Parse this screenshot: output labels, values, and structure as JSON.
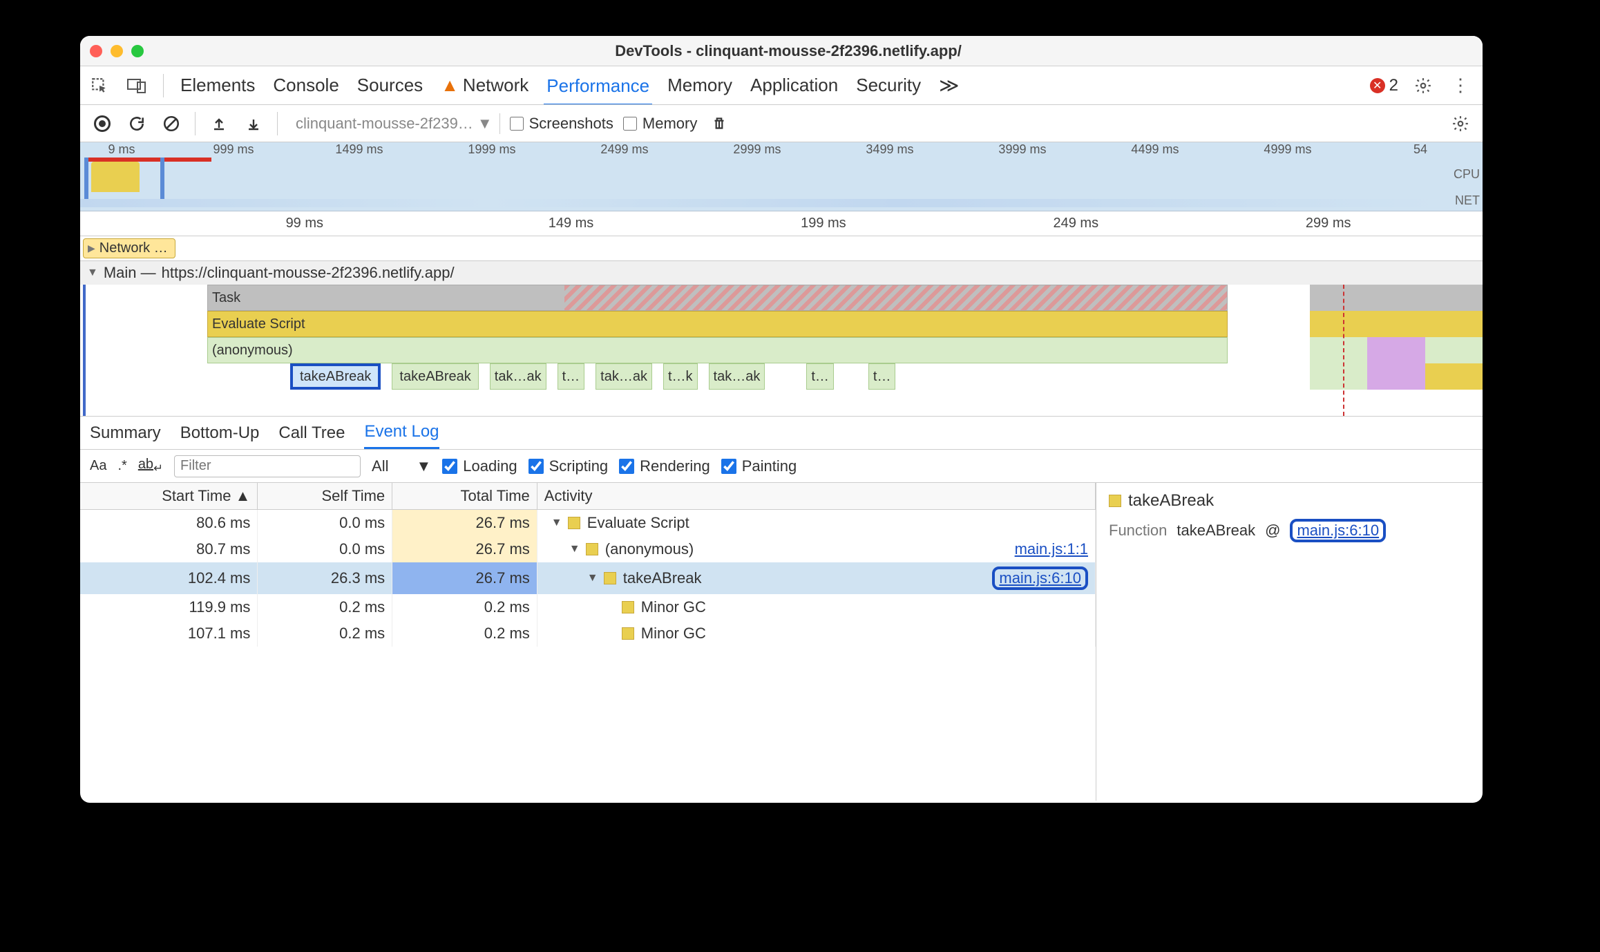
{
  "window": {
    "title": "DevTools - clinquant-mousse-2f2396.netlify.app/"
  },
  "tabs": {
    "items": [
      "Elements",
      "Console",
      "Sources",
      "Network",
      "Performance",
      "Memory",
      "Application",
      "Security"
    ],
    "network_warning": true,
    "active": "Performance",
    "overflow_glyph": "≫",
    "errors": "2"
  },
  "toolbar": {
    "profile_name": "clinquant-mousse-2f239…",
    "screenshots_label": "Screenshots",
    "memory_label": "Memory"
  },
  "overview": {
    "ticks": [
      "9 ms",
      "999 ms",
      "1499 ms",
      "1999 ms",
      "2499 ms",
      "2999 ms",
      "3499 ms",
      "3999 ms",
      "4499 ms",
      "4999 ms",
      "54"
    ],
    "cpu": "CPU",
    "net": "NET"
  },
  "ruler": {
    "ticks": [
      "99 ms",
      "149 ms",
      "199 ms",
      "249 ms",
      "299 ms"
    ]
  },
  "network_pill": "Network …",
  "mainframe": {
    "title_prefix": "Main —",
    "url": "https://clinquant-mousse-2f2396.netlify.app/",
    "rows": {
      "task": "Task",
      "eval": "Evaluate Script",
      "anon": "(anonymous)"
    },
    "calls": [
      "takeABreak",
      "takeABreak",
      "tak…ak",
      "t…",
      "tak…ak",
      "t…k",
      "tak…ak",
      "t…",
      "t…"
    ]
  },
  "subtabs": {
    "items": [
      "Summary",
      "Bottom-Up",
      "Call Tree",
      "Event Log"
    ],
    "active": "Event Log"
  },
  "filter": {
    "case": "Aa",
    "regex": ".*",
    "whole": "ab",
    "placeholder": "Filter",
    "scope": "All",
    "loading": "Loading",
    "scripting": "Scripting",
    "rendering": "Rendering",
    "painting": "Painting"
  },
  "columns": {
    "start": "Start Time",
    "self": "Self Time",
    "total": "Total Time",
    "activity": "Activity"
  },
  "rows": [
    {
      "start": "80.6 ms",
      "self": "0.0 ms",
      "total": "26.7 ms",
      "activity": "Evaluate Script",
      "depth": 0,
      "arrow": true,
      "link": "",
      "sel": false,
      "tthi": true
    },
    {
      "start": "80.7 ms",
      "self": "0.0 ms",
      "total": "26.7 ms",
      "activity": "(anonymous)",
      "depth": 1,
      "arrow": true,
      "link": "main.js:1:1",
      "sel": false,
      "tthi": true
    },
    {
      "start": "102.4 ms",
      "self": "26.3 ms",
      "total": "26.7 ms",
      "activity": "takeABreak",
      "depth": 2,
      "arrow": true,
      "link": "main.js:6:10",
      "sel": true,
      "ttsel": true,
      "linkring": true
    },
    {
      "start": "119.9 ms",
      "self": "0.2 ms",
      "total": "0.2 ms",
      "activity": "Minor GC",
      "depth": 3,
      "arrow": false,
      "link": "",
      "sel": false
    },
    {
      "start": "107.1 ms",
      "self": "0.2 ms",
      "total": "0.2 ms",
      "activity": "Minor GC",
      "depth": 3,
      "arrow": false,
      "link": "",
      "sel": false
    }
  ],
  "detail": {
    "title": "takeABreak",
    "label": "Function",
    "func": "takeABreak",
    "at": "@",
    "link": "main.js:6:10"
  }
}
